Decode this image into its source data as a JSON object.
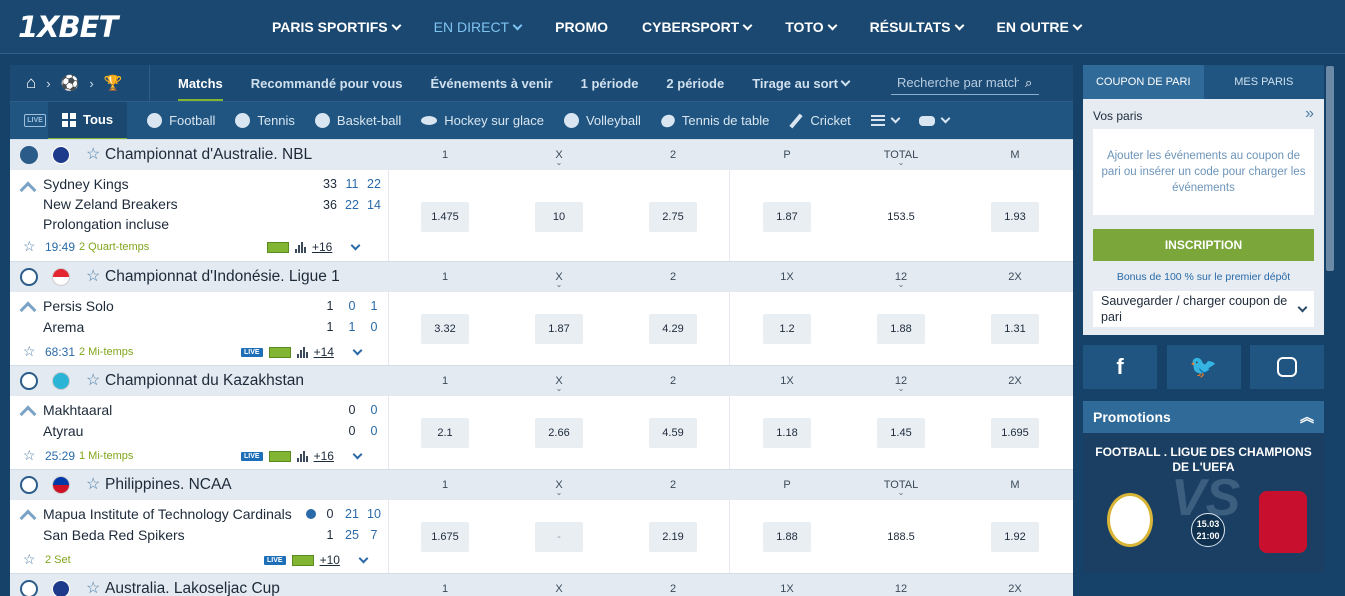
{
  "header": {
    "logo": "1XBET",
    "nav": [
      {
        "label": "PARIS SPORTIFS",
        "active": false
      },
      {
        "label": "EN DIRECT",
        "active": true
      },
      {
        "label": "PROMO",
        "active": false
      },
      {
        "label": "CYBERSPORT",
        "active": false
      },
      {
        "label": "TOTO",
        "active": false
      },
      {
        "label": "RÉSULTATS",
        "active": false
      },
      {
        "label": "EN OUTRE",
        "active": false
      }
    ]
  },
  "subnav": {
    "tabs": [
      "Matchs",
      "Recommandé pour vous",
      "Événements à venir",
      "1 période",
      "2 période",
      "Tirage au sort"
    ],
    "search_placeholder": "Recherche par match"
  },
  "sports": {
    "live_label": "LIVE",
    "items": [
      "Tous",
      "Football",
      "Tennis",
      "Basket-ball",
      "Hockey sur glace",
      "Volleyball",
      "Tennis de table",
      "Cricket"
    ]
  },
  "leagues": [
    {
      "name": "Championnat d'Australie. NBL",
      "cols": [
        "1",
        "X",
        "2",
        "P",
        "TOTAL",
        "M"
      ],
      "match": {
        "teams": [
          "Sydney Kings",
          "New Zeland Breakers",
          "Prolongation incluse"
        ],
        "scores": [
          [
            "33",
            "11",
            "22"
          ],
          [
            "36",
            "22",
            "14"
          ]
        ],
        "time": "19:49",
        "period": "2 Quart-temps",
        "more": "+16",
        "odds": [
          "1.475",
          "10",
          "2.75",
          "1.87",
          "153.5",
          "1.93"
        ]
      }
    },
    {
      "name": "Championnat d'Indonésie. Ligue 1",
      "cols": [
        "1",
        "X",
        "2",
        "1X",
        "12",
        "2X"
      ],
      "match": {
        "teams": [
          "Persis Solo",
          "Arema"
        ],
        "scores": [
          [
            "1",
            "0",
            "1"
          ],
          [
            "1",
            "1",
            "0"
          ]
        ],
        "time": "68:31",
        "period": "2 Mi-temps",
        "more": "+14",
        "odds": [
          "3.32",
          "1.87",
          "4.29",
          "1.2",
          "1.88",
          "1.31"
        ]
      }
    },
    {
      "name": "Championnat du Kazakhstan",
      "cols": [
        "1",
        "X",
        "2",
        "1X",
        "12",
        "2X"
      ],
      "match": {
        "teams": [
          "Makhtaaral",
          "Atyrau"
        ],
        "scores": [
          [
            "0",
            "0"
          ],
          [
            "0",
            "0"
          ]
        ],
        "time": "25:29",
        "period": "1 Mi-temps",
        "more": "+16",
        "odds": [
          "2.1",
          "2.66",
          "4.59",
          "1.18",
          "1.45",
          "1.695"
        ]
      }
    },
    {
      "name": "Philippines. NCAA",
      "cols": [
        "1",
        "X",
        "2",
        "P",
        "TOTAL",
        "M"
      ],
      "match": {
        "teams": [
          "Mapua Institute of Technology Cardinals",
          "San Beda Red Spikers"
        ],
        "scores": [
          [
            "0",
            "21",
            "10"
          ],
          [
            "1",
            "25",
            "7"
          ]
        ],
        "time": "",
        "period": "2 Set",
        "more": "+10",
        "odds": [
          "1.675",
          "-",
          "2.19",
          "1.88",
          "188.5",
          "1.92"
        ]
      }
    },
    {
      "name": "Australia. Lakoseljac Cup",
      "cols": [
        "1",
        "X",
        "2",
        "1X",
        "12",
        "2X"
      ]
    }
  ],
  "coupon": {
    "tabs": [
      "COUPON DE PARI",
      "MES PARIS"
    ],
    "vos_paris": "Vos paris",
    "empty_text": "Ajouter les événements au coupon de pari ou insérer un code pour charger les événements",
    "register": "INSCRIPTION",
    "bonus": "Bonus de 100 % sur le premier dépôt",
    "save": "Sauvegarder / charger coupon de pari"
  },
  "promotions": {
    "title": "Promotions",
    "banner_title": "FOOTBALL . LIGUE DES CHAMPIONS DE L'UEFA",
    "date": "15.03",
    "time": "21:00",
    "vs": "VS"
  },
  "live_badge": "LIVE"
}
